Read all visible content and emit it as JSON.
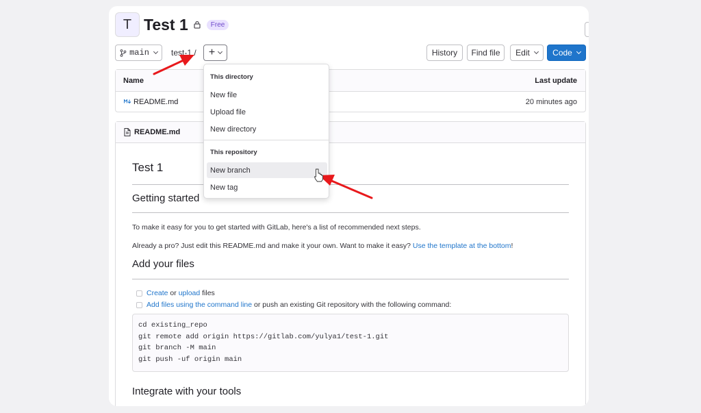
{
  "project": {
    "avatar_letter": "T",
    "title": "Test 1",
    "badge": "Free"
  },
  "toolbar": {
    "branch": "main",
    "breadcrumb": "test-1 /",
    "history_label": "History",
    "find_file_label": "Find file",
    "edit_label": "Edit",
    "code_label": "Code",
    "accent_color": "#1f75cb"
  },
  "files": {
    "headers": [
      "Name",
      "Last update"
    ],
    "rows": [
      {
        "name": "README.md",
        "updated": "20 minutes ago"
      }
    ]
  },
  "dropdown": {
    "group1_title": "This directory",
    "group1_items": [
      "New file",
      "Upload file",
      "New directory"
    ],
    "group2_title": "This repository",
    "group2_items": [
      "New branch",
      "New tag"
    ],
    "hovered_item": "New branch"
  },
  "readme": {
    "header_label": "README.md",
    "h1": "Test 1",
    "h2_getting_started": "Getting started",
    "p1": "To make it easy for you to get started with GitLab, here's a list of recommended next steps.",
    "p2_text": "Already a pro? Just edit this README.md and make it your own. Want to make it easy? ",
    "p2_link": "Use the template at the bottom",
    "p2_end": "!",
    "h2_add_files": "Add your files",
    "task1_link1": "Create",
    "task1_mid": " or ",
    "task1_link2": "upload",
    "task1_end": " files",
    "task2_link": "Add files using the command line",
    "task2_end": " or push an existing Git repository with the following command:",
    "code_lines": [
      "cd existing_repo",
      "git remote add origin https://gitlab.com/yulya1/test-1.git",
      "git branch -M main",
      "git push -uf origin main"
    ],
    "h2_integrate": "Integrate with your tools"
  }
}
